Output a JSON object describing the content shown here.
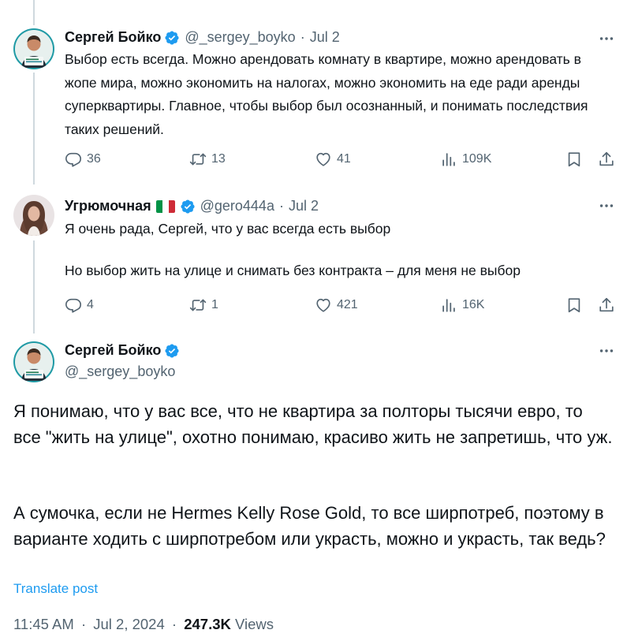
{
  "tweets": [
    {
      "author_name": "Сергей Бойко",
      "handle": "@_sergey_boyko",
      "separator": "·",
      "date": "Jul 2",
      "text": "Выбор есть всегда. Можно арендовать комнату в квартире, можно арендовать в жопе мира, можно экономить на налогах, можно экономить на еде ради аренды суперквартиры. Главное, чтобы выбор был осознанный, и понимать последствия таких решений.",
      "replies": "36",
      "reposts": "13",
      "likes": "41",
      "views": "109K"
    },
    {
      "author_name": "Угрюмочная",
      "handle": "@gero444a",
      "separator": "·",
      "date": "Jul 2",
      "text_line1": "Я очень рада, Сергей, что у вас всегда есть выбор",
      "text_line2": "Но выбор жить на улице и снимать без контракта – для меня не выбор",
      "replies": "4",
      "reposts": "1",
      "likes": "421",
      "views": "16K"
    }
  ],
  "main_tweet": {
    "author_name": "Сергей Бойко",
    "handle": "@_sergey_boyko",
    "paragraph1": "Я понимаю, что у вас все, что не квартира за полторы тысячи евро, то все \"жить на улице\", охотно понимаю, красиво жить не запретишь, что уж.",
    "paragraph2": "А сумочка, если не Hermes Kelly Rose Gold, то все ширпотреб, поэтому в варианте ходить с ширпотребом или украсть, можно и украсть, так ведь?",
    "translate_label": "Translate post",
    "time": "11:45 AM",
    "separator": "·",
    "date": "Jul 2, 2024",
    "views_count": "247.3K",
    "views_label": "Views"
  },
  "colors": {
    "accent": "#1d9bf0",
    "text": "#0f1419",
    "secondary": "#536471",
    "thread_line": "#cfd9de"
  },
  "icons": [
    "verified-badge-icon",
    "more-icon",
    "reply-icon",
    "repost-icon",
    "like-icon",
    "views-icon",
    "bookmark-icon",
    "share-icon",
    "italy-flag-icon"
  ]
}
